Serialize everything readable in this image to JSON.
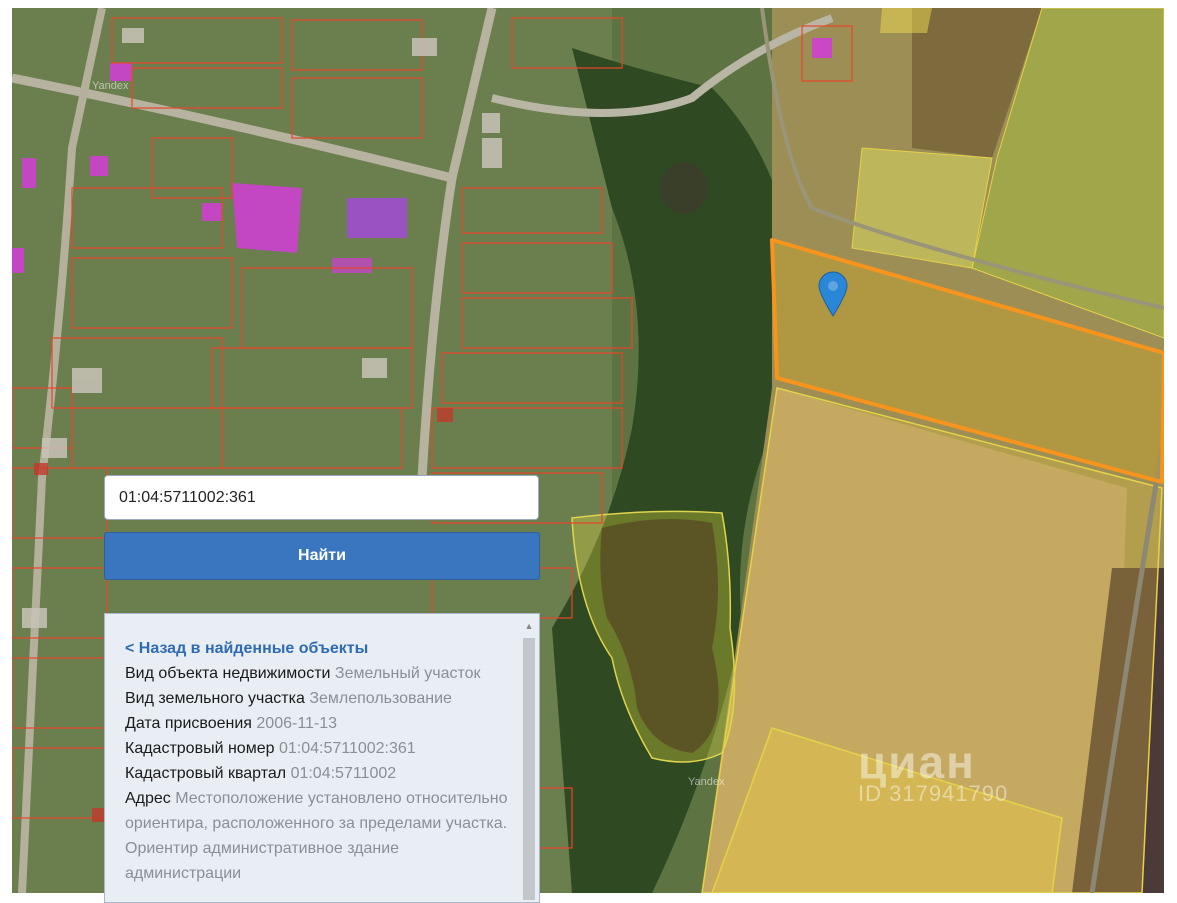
{
  "map": {
    "attribution": "Yandex",
    "watermark": {
      "logo": "циан",
      "id": "ID 317941790"
    }
  },
  "search": {
    "value": "01:04:5711002:361"
  },
  "find_button": {
    "label": "Найти"
  },
  "info_panel": {
    "back_link": "< Назад в найденные объекты",
    "rows": [
      {
        "key": "Вид объекта недвижимости",
        "value": "Земельный участок"
      },
      {
        "key": "Вид земельного участка",
        "value": "Землепользование"
      },
      {
        "key": "Дата присвоения",
        "value": "2006-11-13"
      },
      {
        "key": "Кадастровый номер",
        "value": "01:04:5711002:361"
      },
      {
        "key": "Кадастровый квартал",
        "value": "01:04:5711002"
      },
      {
        "key": "Адрес",
        "value": "Местоположение установлено относительно ориентира, расположенного за пределами участка. Ориентир административное здание администрации"
      }
    ]
  },
  "colors": {
    "selected_parcel": "#f7941d",
    "parcel_outline": "#e8462a",
    "building": "#d23cd7",
    "button": "#3a76bf",
    "link": "#2f6bb3"
  },
  "icons": {
    "marker": "map-pin-icon",
    "scroll_up": "arrow-up-icon"
  }
}
